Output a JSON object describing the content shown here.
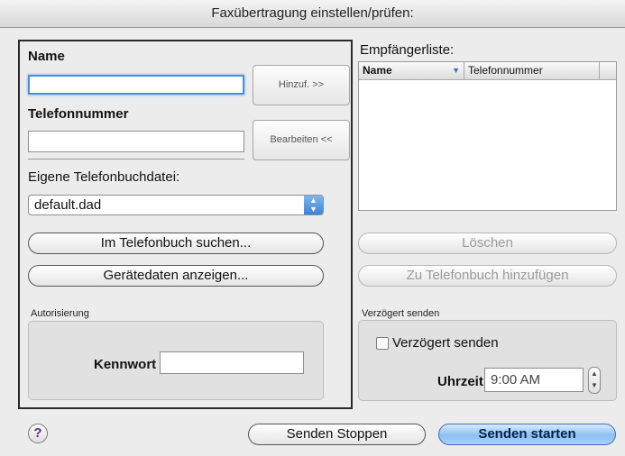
{
  "window": {
    "title": "Faxübertragung einstellen/prüfen:"
  },
  "left_panel": {
    "name_label": "Name",
    "name_value": "",
    "phone_label": "Telefonnummer",
    "phone_value": "",
    "add_button": "Hinzuf. >>",
    "edit_button": "Bearbeiten <<",
    "phonebook_label": "Eigene Telefonbuchdatei:",
    "phonebook_selected": "default.dad",
    "search_button": "Im Telefonbuch suchen...",
    "device_button": "Gerätedaten anzeigen...",
    "auth": {
      "title": "Autorisierung",
      "password_label": "Kennwort",
      "password_value": ""
    }
  },
  "recipients": {
    "title": "Empfängerliste:",
    "columns": [
      "Name",
      "Telefonnummer"
    ],
    "rows": [],
    "delete_button": "Löschen",
    "add_to_phonebook_button": "Zu Telefonbuch hinzufügen"
  },
  "delayed": {
    "title": "Verzögert senden",
    "checkbox_label": "Verzögert senden",
    "checked": false,
    "time_label": "Uhrzeit",
    "time_value": "9:00 AM"
  },
  "footer": {
    "help": "?",
    "stop_button": "Senden Stoppen",
    "start_button": "Senden starten"
  },
  "colors": {
    "accent": "#4a8fd8",
    "primary_button": "#8ec0f1"
  }
}
